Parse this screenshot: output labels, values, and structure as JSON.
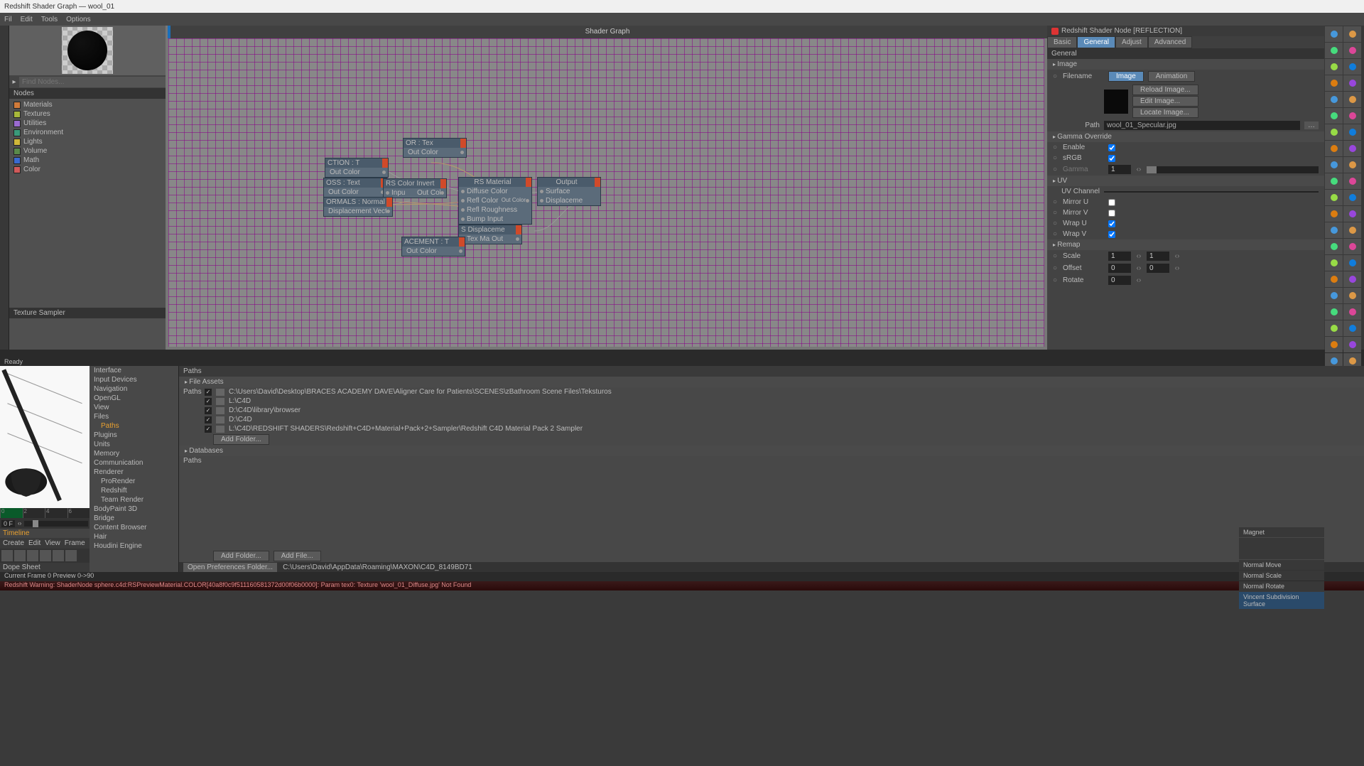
{
  "app_title": "Redshift Shader Graph — wool_01",
  "menus": [
    "Fil",
    "Edit",
    "Tools",
    "Options"
  ],
  "find_placeholder": "Find Nodes...",
  "cats_header": "Nodes",
  "categories": [
    {
      "label": "Materials",
      "color": "#d07a3a"
    },
    {
      "label": "Textures",
      "color": "#a8b83a"
    },
    {
      "label": "Utilities",
      "color": "#9a6ad0"
    },
    {
      "label": "Environment",
      "color": "#3a9a7a"
    },
    {
      "label": "Lights",
      "color": "#d0b83a"
    },
    {
      "label": "Volume",
      "color": "#5a8a4a"
    },
    {
      "label": "Math",
      "color": "#3a6ad0"
    },
    {
      "label": "Color",
      "color": "#d05a5a"
    }
  ],
  "texture_sampler": "Texture Sampler",
  "graph_title": "Shader Graph",
  "nodes": {
    "or": {
      "title": "OR : Tex",
      "out": "Out Color"
    },
    "ction": {
      "title": "CTION : T",
      "out": "Out Color"
    },
    "oss": {
      "title": "OSS : Text",
      "out": "Out Color"
    },
    "invert": {
      "title": "RS Color Invert",
      "in": "Inpu",
      "out": "Out Color"
    },
    "nrm": {
      "title": "ORMALS : Normal M",
      "out": "Displacement Vector"
    },
    "mat": {
      "title": "RS Material",
      "rows": [
        "Diffuse Color",
        "Refl Color",
        "Refl Roughness",
        "Bump Input"
      ],
      "out": "Out Color"
    },
    "out": {
      "title": "Output",
      "rows": [
        "Surface",
        "Displaceme"
      ]
    },
    "disp": {
      "title": "S Displaceme",
      "out": "Tex Ma  Out"
    },
    "cement": {
      "title": "ACEMENT : T",
      "out": "Out Color"
    }
  },
  "props": {
    "header": "Redshift Shader Node [REFLECTION]",
    "tabs": [
      "Basic",
      "General",
      "Adjust",
      "Advanced"
    ],
    "section": "General",
    "image_group": "Image",
    "filename": "Filename",
    "img_tabs": [
      "Image",
      "Animation"
    ],
    "reload": "Reload Image...",
    "edit": "Edit Image...",
    "locate": "Locate Image...",
    "path_lbl": "Path",
    "path": "wool_01_Specular.jpg",
    "gamma_group": "Gamma Override",
    "enable": "Enable",
    "srgb": "sRGB",
    "gamma": "Gamma",
    "gamma_val": "1",
    "uv_group": "UV",
    "uv_channel": "UV Channel",
    "mirror_u": "Mirror U",
    "mirror_v": "Mirror V",
    "wrap_u": "Wrap U",
    "wrap_v": "Wrap V",
    "remap_group": "Remap",
    "scale": "Scale",
    "scale_a": "1",
    "scale_b": "1",
    "offset": "Offset",
    "off_a": "0",
    "off_b": "0",
    "rotate": "Rotate",
    "rot": "0"
  },
  "ready": "Ready",
  "tree": [
    {
      "label": "Interface"
    },
    {
      "label": "Input Devices"
    },
    {
      "label": "Navigation"
    },
    {
      "label": "OpenGL"
    },
    {
      "label": "View"
    },
    {
      "label": "Files"
    },
    {
      "label": "Paths",
      "sel": true,
      "ind": true
    },
    {
      "label": "Plugins"
    },
    {
      "label": "Units"
    },
    {
      "label": "Memory"
    },
    {
      "label": "Communication"
    },
    {
      "label": "Renderer"
    },
    {
      "label": "ProRender",
      "ind": true
    },
    {
      "label": "Redshift",
      "ind": true
    },
    {
      "label": "Team Render",
      "ind": true
    },
    {
      "label": "BodyPaint 3D"
    },
    {
      "label": "Bridge"
    },
    {
      "label": "Content Browser"
    },
    {
      "label": "Hair"
    },
    {
      "label": "Houdini Engine"
    }
  ],
  "prefs": {
    "paths_hdr": "Paths",
    "file_assets": "File Assets",
    "paths_lbl": "Paths",
    "rows": [
      "C:\\Users\\David\\Desktop\\BRACES ACADEMY DAVE\\Aligner Care for Patients\\SCENES\\zBathroom Scene Files\\Teksturos",
      "L:\\C4D",
      "D:\\C4D\\library\\browser",
      "D:\\C4D",
      "L:\\C4D\\REDSHIFT SHADERS\\Redshift+C4D+Material+Pack+2+Sampler\\Redshift C4D Material Pack 2 Sampler"
    ],
    "add_folder": "Add Folder...",
    "databases": "Databases",
    "add_file": "Add File...",
    "open_pref": "Open Preferences Folder...",
    "pref_path": "C:\\Users\\David\\AppData\\Roaming\\MAXON\\C4D_8149BD71"
  },
  "tl": {
    "ticks": [
      "0",
      "2",
      "4",
      "6"
    ],
    "label": "Timeline",
    "create": "Create",
    "edit": "Edit",
    "view": "View",
    "frame": "Frame",
    "dope": "Dope Sheet",
    "cur": "0 F"
  },
  "status_frame": "Current Frame  0   Preview  0->90",
  "status_err": "Redshift Warning: ShaderNode sphere.c4d:RSPreviewMaterial.COLOR[40a8f0c9f511160581372d00f06b0000]: Param tex0: Texture 'wool_01_Diffuse.jpg' Not Found",
  "magnet": "Magnet",
  "magnet_items": [
    "",
    "Normal Move",
    "Normal Scale",
    "Normal Rotate",
    "Vincent Subdivision Surface"
  ],
  "chart_data": null
}
